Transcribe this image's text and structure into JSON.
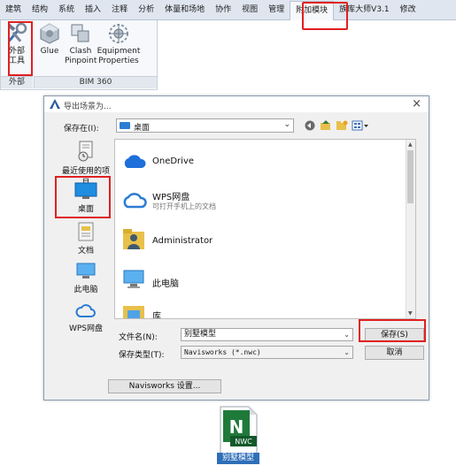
{
  "ribbon": {
    "tabs": [
      "建筑",
      "结构",
      "系统",
      "插入",
      "注释",
      "分析",
      "体量和场地",
      "协作",
      "视图",
      "管理",
      "附加模块",
      "族库大师V3.1",
      "修改"
    ],
    "active_tab": "附加模块",
    "buttons": {
      "external_tools": "外部\n工具",
      "glue": "Glue",
      "clash_pinpoint": "Clash\nPinpoint",
      "equipment_properties": "Equipment\nProperties"
    },
    "panels": {
      "external": "外部",
      "bim360": "BIM 360"
    },
    "icons": [
      "tools-icon",
      "glue-icon",
      "clash-icon",
      "equipment-icon"
    ]
  },
  "dialog": {
    "title": "导出场景为...",
    "save_in_label": "保存在(I):",
    "save_in_value": "桌面",
    "places": [
      {
        "label": "最近使用的项目",
        "icon": "recent-icon"
      },
      {
        "label": "桌面",
        "icon": "desktop-icon"
      },
      {
        "label": "文档",
        "icon": "documents-icon"
      },
      {
        "label": "此电脑",
        "icon": "computer-icon"
      },
      {
        "label": "WPS网盘",
        "icon": "cloud-icon"
      }
    ],
    "files": [
      {
        "name": "OneDrive",
        "sub": "",
        "icon": "onedrive-icon"
      },
      {
        "name": "WPS网盘",
        "sub": "可打开手机上的文档",
        "icon": "wps-cloud-icon"
      },
      {
        "name": "Administrator",
        "sub": "",
        "icon": "user-folder-icon"
      },
      {
        "name": "此电脑",
        "sub": "",
        "icon": "computer-icon"
      },
      {
        "name": "库",
        "sub": "",
        "icon": "library-icon"
      }
    ],
    "file_name_label": "文件名(N):",
    "file_name_value": "别墅模型",
    "file_type_label": "保存类型(T):",
    "file_type_value": "Navisworks (*.nwc)",
    "save_button": "保存(S)",
    "cancel_button": "取消",
    "options_button": "Navisworks 设置..."
  },
  "output_file": {
    "badge": "NWC",
    "name": "别墅模型"
  },
  "colors": {
    "highlight": "#e02020",
    "accent_blue": "#2b7cd3",
    "nwc_green": "#1f7a3a"
  }
}
